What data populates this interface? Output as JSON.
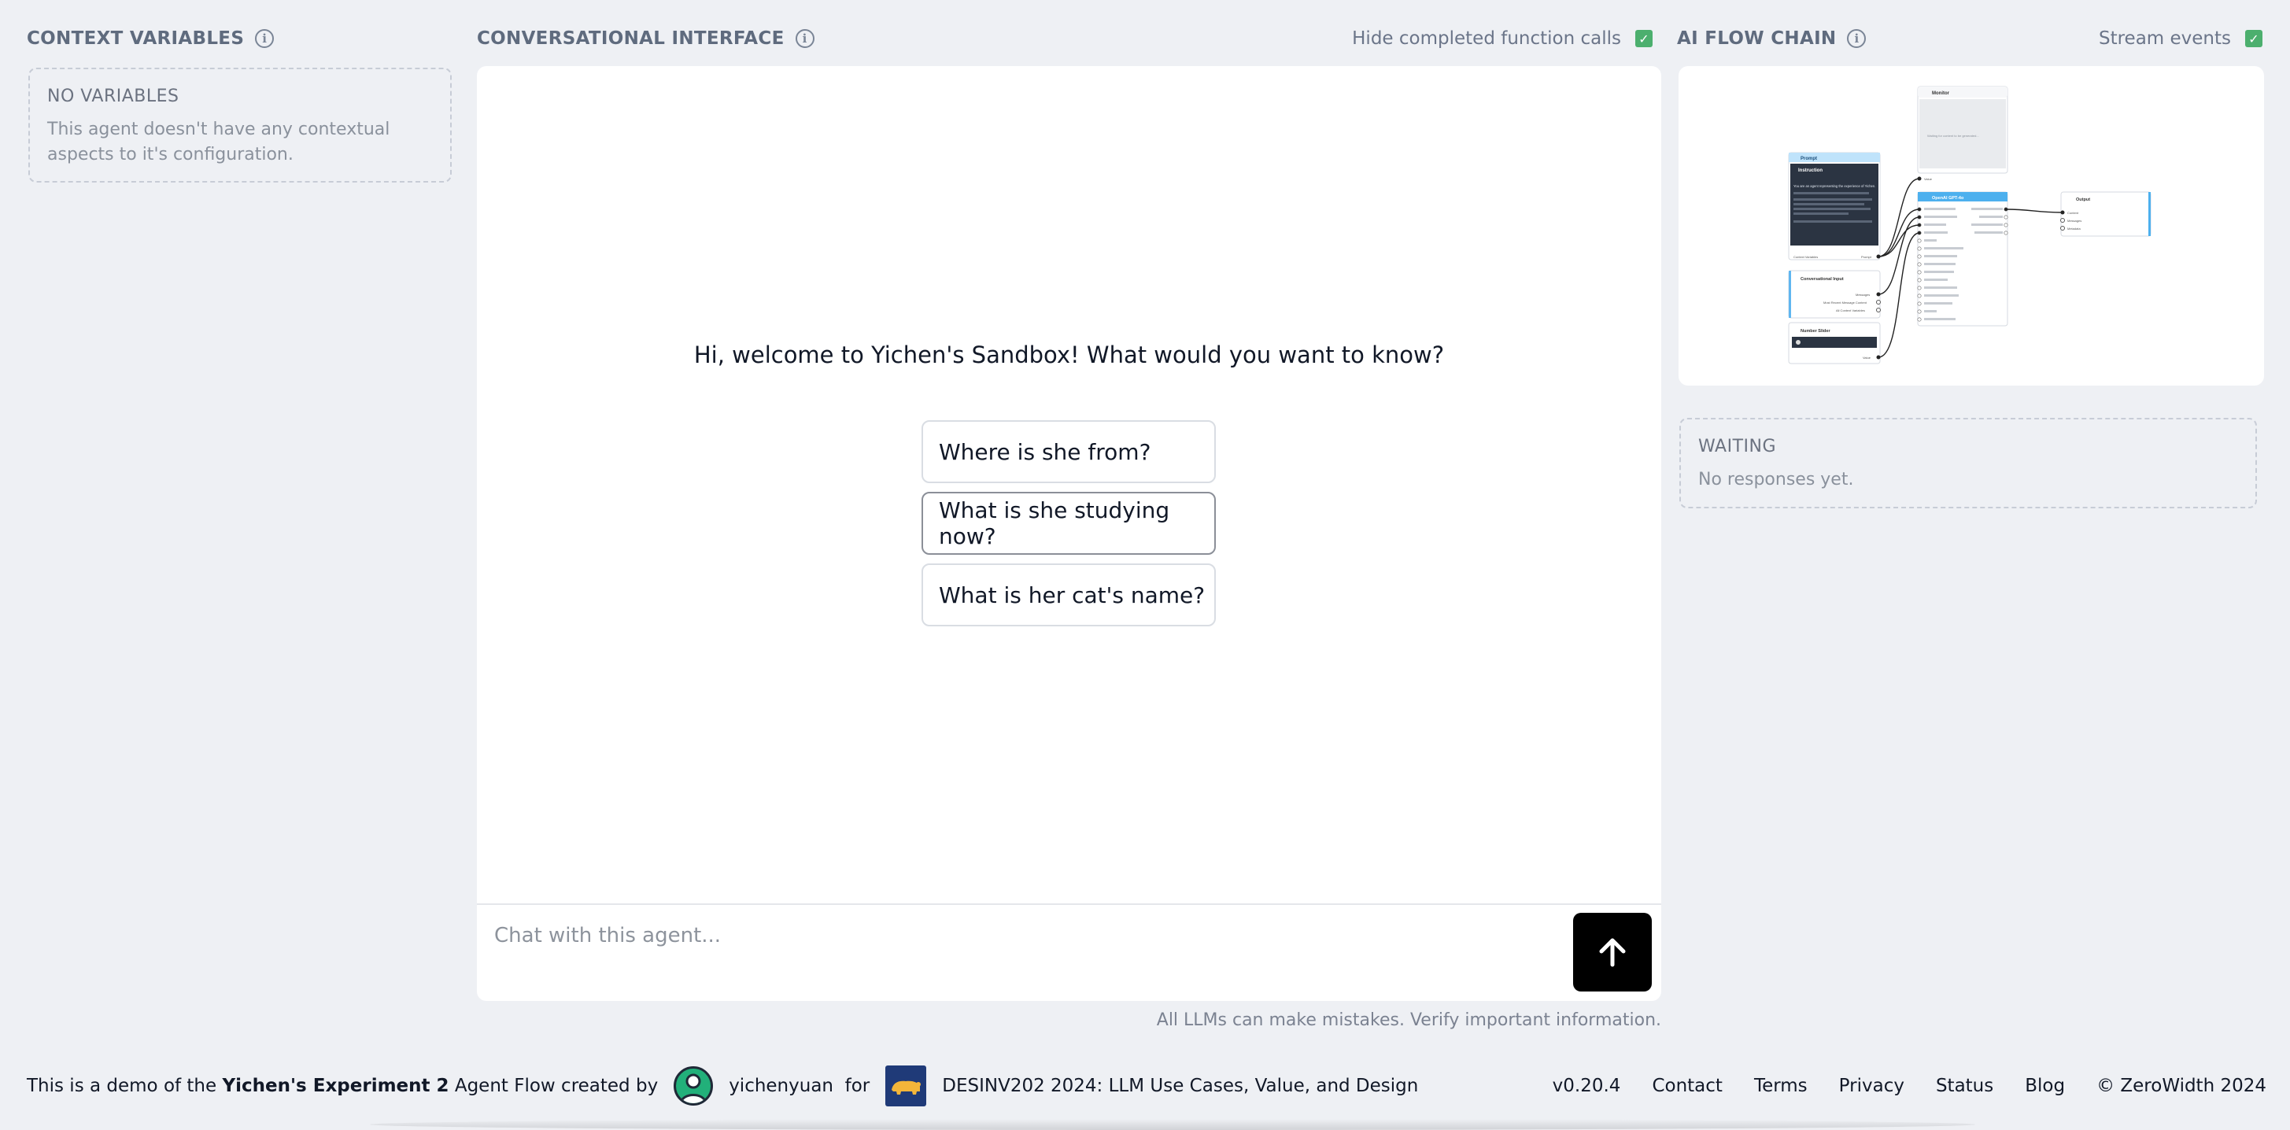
{
  "context": {
    "heading": "CONTEXT VARIABLES",
    "empty_title": "NO VARIABLES",
    "empty_text": "This agent doesn't have any contextual aspects to it's configuration."
  },
  "chat": {
    "heading": "CONVERSATIONAL INTERFACE",
    "hide_label": "Hide completed function calls",
    "welcome": "Hi, welcome to Yichen's Sandbox! What would you want to know?",
    "suggestions": [
      "Where is she from?",
      "What is she studying now?",
      "What is her cat's name?"
    ],
    "input_placeholder": "Chat with this agent...",
    "disclaimer": "All LLMs can make mistakes. Verify important information."
  },
  "flow": {
    "heading": "AI FLOW CHAIN",
    "stream_label": "Stream events",
    "waiting_title": "WAITING",
    "waiting_text": "No responses yet.",
    "diagram": {
      "monitor": "Monitor",
      "monitor_text": "Waiting for content to be generated...",
      "prompt": "Prompt",
      "instruction": "Instruction",
      "instruction_text": "You are an agent representing the experience of Yichen.",
      "context_vars": "Context Variables",
      "prompt_port": "Prompt",
      "conv_input": "Conversational Input",
      "messages": "Messages",
      "most_recent": "Most Recent Message Content",
      "all_context": "All Context Variables",
      "number_slider": "Number Slider",
      "value": "Value",
      "openai": "OpenAI GPT-4o",
      "output": "Output",
      "content": "Content",
      "messages_out": "Messages",
      "metadata": "Metadata"
    }
  },
  "footer": {
    "prefix": "This is a demo of the",
    "agent_name": "Yichen's Experiment 2",
    "mid": "Agent Flow created by",
    "username": "yichenyuan",
    "for": "for",
    "course": "DESINV202 2024: LLM Use Cases, Value, and Design",
    "links": [
      "v0.20.4",
      "Contact",
      "Terms",
      "Privacy",
      "Status",
      "Blog",
      "© ZeroWidth 2024"
    ]
  },
  "colors": {
    "background": "#eef0f4",
    "accent_green": "#4caf6e",
    "send_button": "#000000"
  }
}
